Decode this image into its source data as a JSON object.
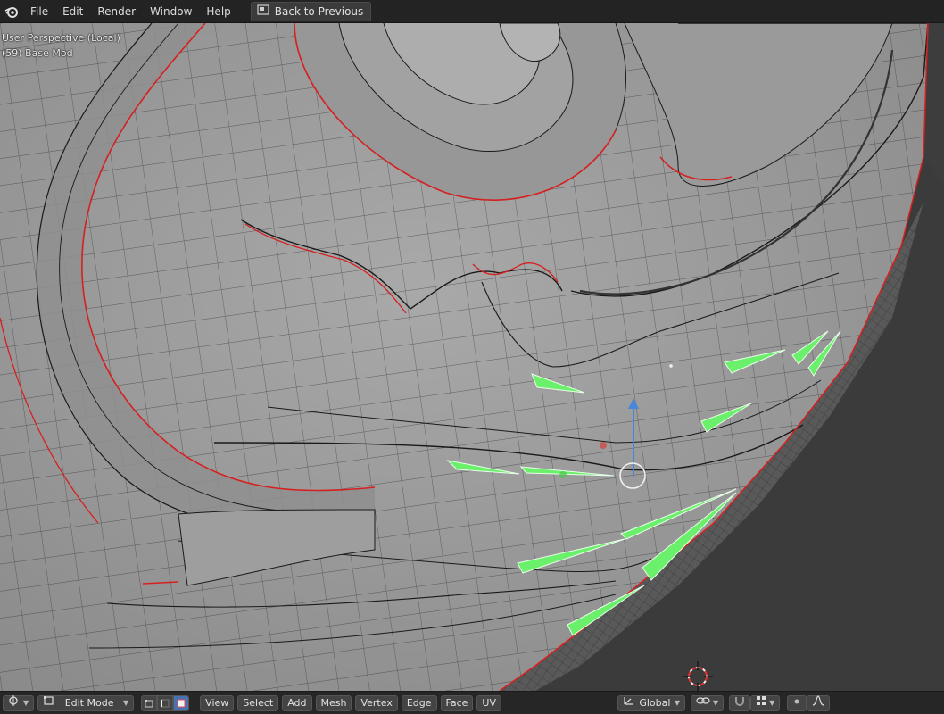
{
  "topbar": {
    "menus": [
      "File",
      "Edit",
      "Render",
      "Window",
      "Help"
    ],
    "back_button": "Back to Previous"
  },
  "viewport": {
    "perspective_label": "User Perspective (Local)",
    "object_label": "(59) Base Mod"
  },
  "bottombar": {
    "mode": "Edit Mode",
    "menus": [
      "View",
      "Select",
      "Add",
      "Mesh",
      "Vertex",
      "Edge",
      "Face",
      "UV"
    ],
    "transform_orientation": "Global"
  },
  "colors": {
    "mesh": "#9c9c9c",
    "wire": "#1a1a1a",
    "seam": "#d62020",
    "selected_face": "#6af06a",
    "gizmo_blue": "#4a86d8",
    "active_mode": "#4772b3"
  }
}
